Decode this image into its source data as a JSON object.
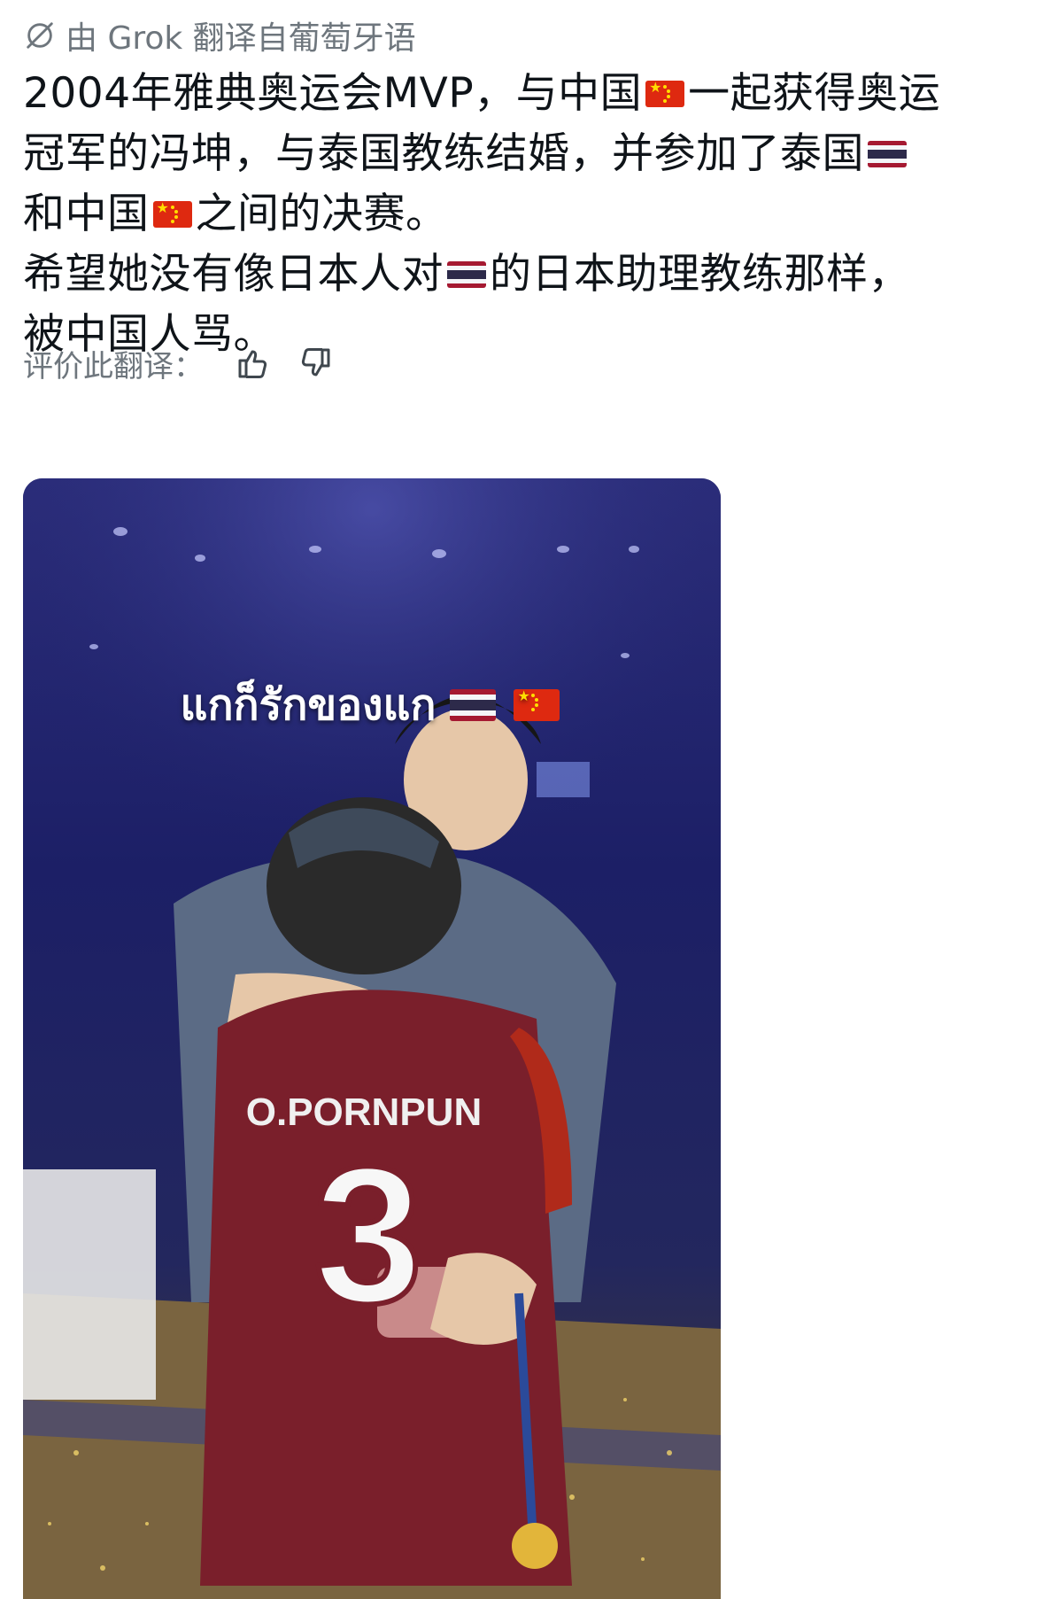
{
  "translation": {
    "attribution": "由 Grok 翻译自葡萄牙语",
    "icon": "translate-slash-icon"
  },
  "post": {
    "lines": [
      [
        "2004年雅典奥运会MVP，与中国",
        "{cn}",
        "一起获得奥运"
      ],
      [
        "冠军的冯坤，与泰国教练结婚，并参加了泰国",
        "{th}"
      ],
      [
        "和中国",
        "{cn}",
        "之间的决赛。"
      ],
      [
        "希望她没有像日本人对",
        "{th}",
        "的日本助理教练那样，"
      ],
      [
        "被中国人骂。"
      ]
    ],
    "l1a": "2004年雅典奥运会MVP，与中国",
    "l1b": "一起获得奥运",
    "l2a": "冠军的冯坤，与泰国教练结婚，并参加了泰国",
    "l3a": "和中国",
    "l3b": "之间的决赛。",
    "l4a": "希望她没有像日本人对",
    "l4b": "的日本助理教练那样，",
    "l5a": "被中国人骂。"
  },
  "rating": {
    "label": "评价此翻译：",
    "thumbs_up_icon": "thumbs-up-icon",
    "thumbs_down_icon": "thumbs-down-icon"
  },
  "media": {
    "caption": "แกก็รักของแก",
    "caption_flags": [
      "thailand-flag",
      "china-flag"
    ],
    "jersey_name": "O.PORNPUN",
    "jersey_number": "3"
  },
  "colors": {
    "text": "#0f1419",
    "muted": "#6e767d",
    "arena_blue": "#1a1f5a",
    "jersey": "#7a1f2b"
  }
}
